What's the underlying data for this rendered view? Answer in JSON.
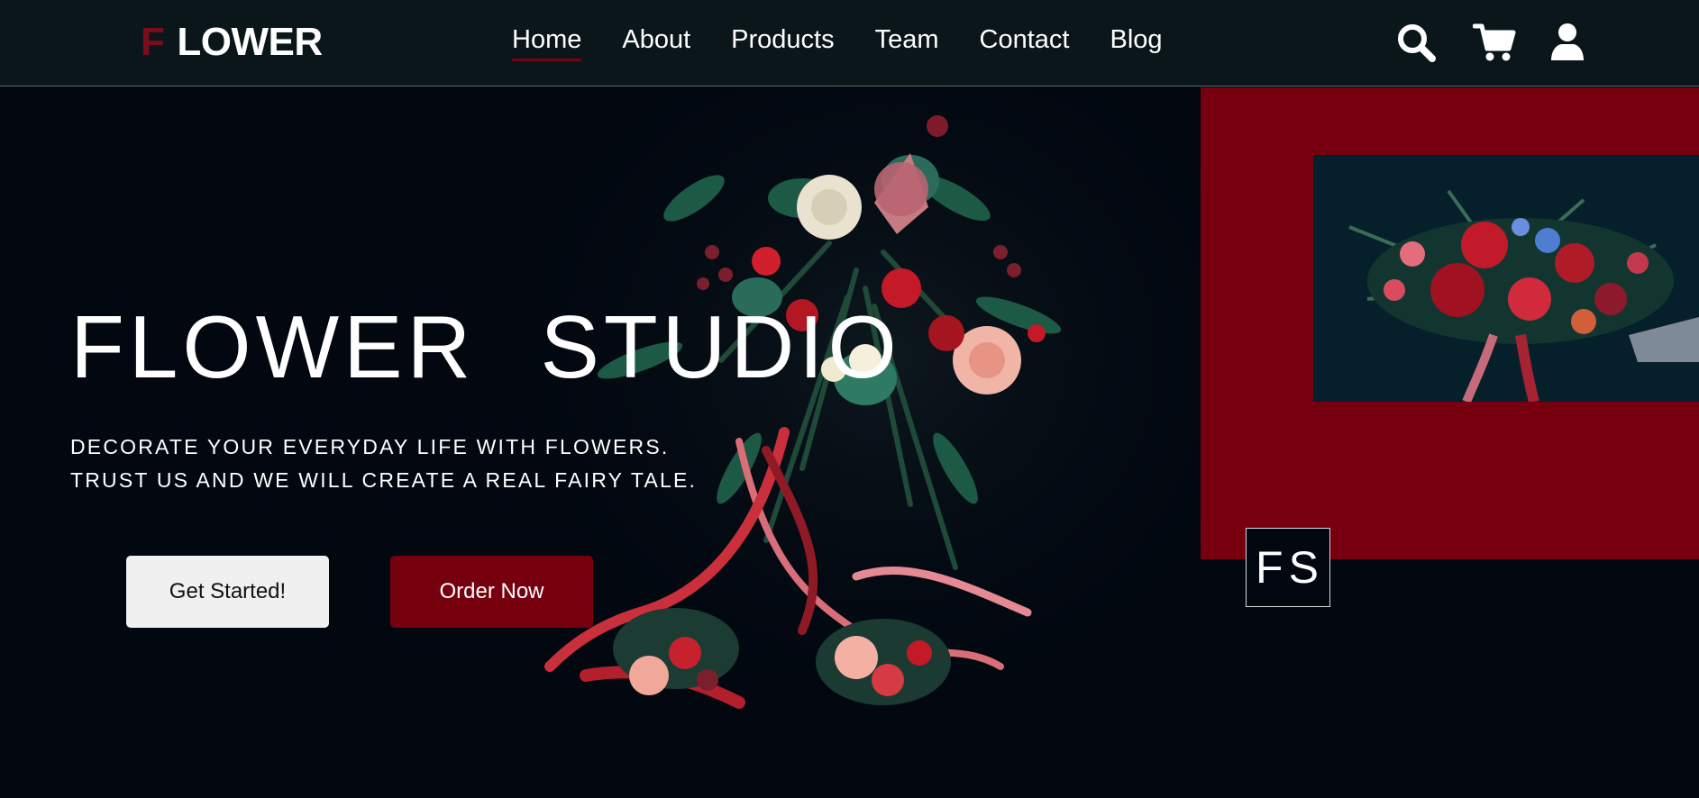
{
  "brand": {
    "initial": "F",
    "name": "LOWER",
    "initial_color": "#7a0d1b"
  },
  "nav": {
    "items": [
      {
        "label": "Home",
        "active": true
      },
      {
        "label": "About",
        "active": false
      },
      {
        "label": "Products",
        "active": false
      },
      {
        "label": "Team",
        "active": false
      },
      {
        "label": "Contact",
        "active": false
      },
      {
        "label": "Blog",
        "active": false
      }
    ],
    "icons": [
      "search-icon",
      "cart-icon",
      "user-icon"
    ]
  },
  "hero": {
    "title": "FLOWER STUDIO",
    "subtitle_line1": "DECORATE YOUR EVERYDAY LIFE WITH FLOWERS.",
    "subtitle_line2": "TRUST US AND WE WILL CREATE A REAL FAIRY TALE.",
    "primary_button": "Get Started!",
    "secondary_button": "Order Now"
  },
  "side": {
    "badge": "FS"
  },
  "colors": {
    "accent": "#76000f",
    "background": "#020710",
    "header": "#0b161b",
    "button_light": "#f0f0f0"
  }
}
